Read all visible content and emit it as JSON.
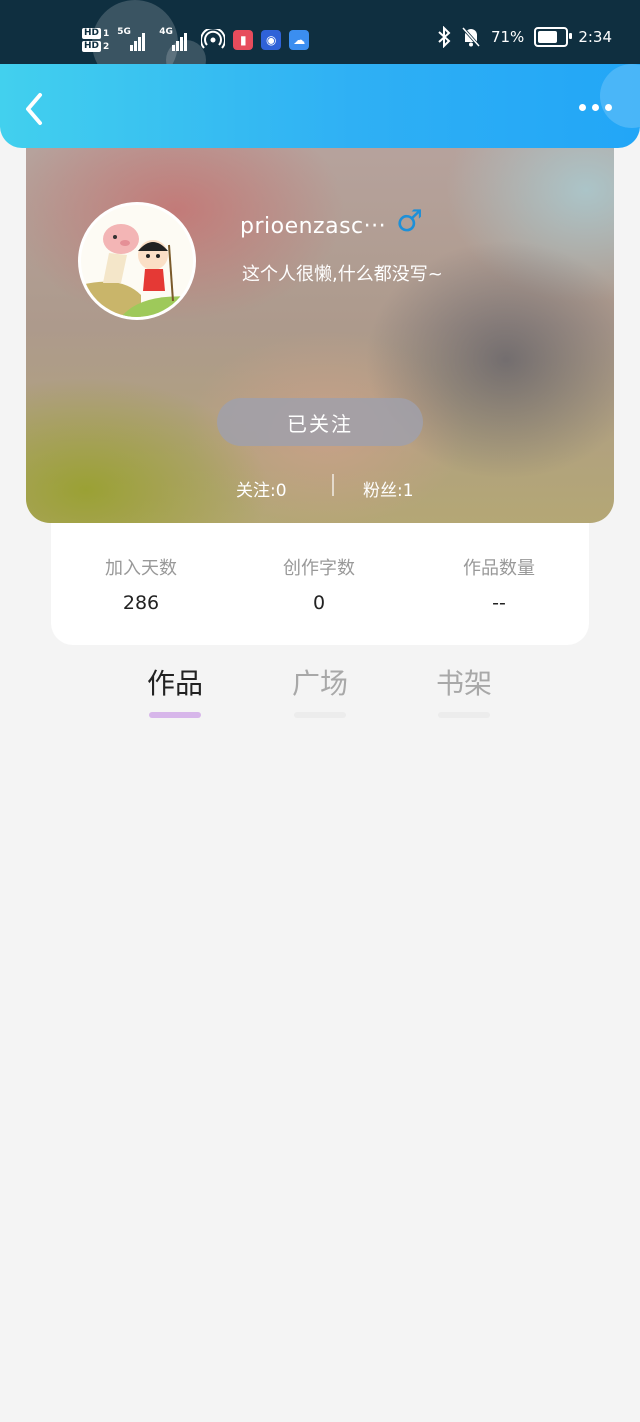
{
  "status_bar": {
    "hd1": "HD",
    "hd1_num": "1",
    "hd2": "HD",
    "hd2_num": "2",
    "net1": "5G",
    "net2": "4G",
    "battery_percent": "71%",
    "battery_level": 0.71,
    "time": "2:34"
  },
  "profile": {
    "username": "prioenzasc···",
    "gender_symbol": "♂",
    "bio": "这个人很懒,什么都没写~",
    "follow_button": "已关注",
    "following": "关注:0",
    "fans": "粉丝:1"
  },
  "stats": [
    {
      "label": "加入天数",
      "value": "286"
    },
    {
      "label": "创作字数",
      "value": "0"
    },
    {
      "label": "作品数量",
      "value": "--"
    }
  ],
  "tabs": [
    {
      "label": "作品",
      "active": true
    },
    {
      "label": "广场",
      "active": false
    },
    {
      "label": "书架",
      "active": false
    }
  ],
  "colors": {
    "header_start": "#42d0ee",
    "header_end": "#22a6f7",
    "active_tab_indicator": "#d7b6ea",
    "gender_icon": "#1e90d8"
  },
  "icons": {
    "back": "chevron-left-icon",
    "more": "more-dots-icon",
    "bluetooth": "bluetooth-icon",
    "mute": "bell-off-icon"
  }
}
